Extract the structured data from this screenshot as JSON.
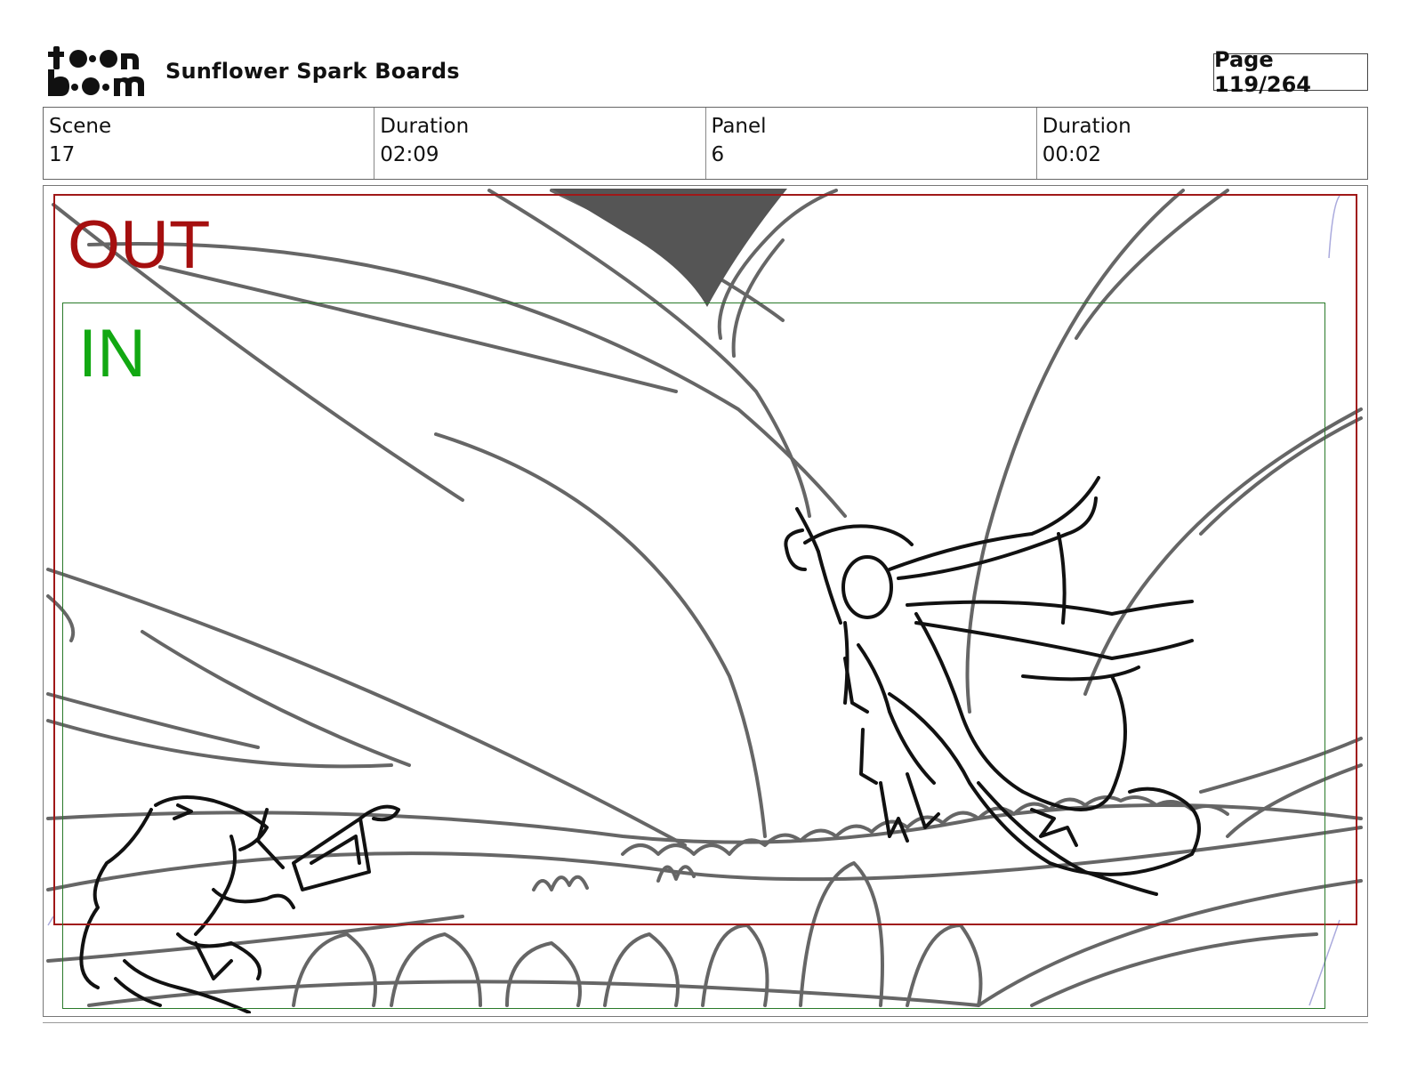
{
  "header": {
    "logo_text_top": "toon",
    "logo_text_bottom": "boom",
    "title": "Sunflower Spark Boards",
    "page": "Page 119/264"
  },
  "info": [
    {
      "label": "Scene",
      "value": "17"
    },
    {
      "label": "Duration",
      "value": "02:09"
    },
    {
      "label": "Panel",
      "value": "6"
    },
    {
      "label": "Duration",
      "value": "00:02"
    }
  ],
  "panel": {
    "out_label": "OUT",
    "in_label": "IN",
    "out_color": "#a50f0f",
    "in_color": "#12a812",
    "sketch_color": "#666666",
    "ink_color": "#111111"
  }
}
